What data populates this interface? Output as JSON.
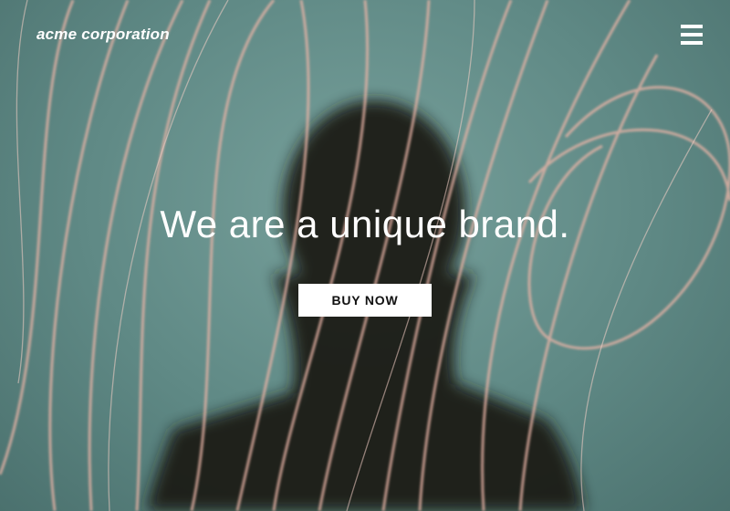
{
  "header": {
    "brand": "acme corporation",
    "menu_icon": "hamburger-menu-icon"
  },
  "hero": {
    "headline": "We are a unique brand.",
    "cta_label": "BUY NOW",
    "background": "photo of silhouetted person behind light-painting streaks on teal background"
  },
  "colors": {
    "background_teal": "#6a9692",
    "silhouette": "#1d1a19",
    "light_streaks": "#e7b3a6",
    "text": "#ffffff",
    "button_bg": "#ffffff",
    "button_text": "#111111"
  }
}
